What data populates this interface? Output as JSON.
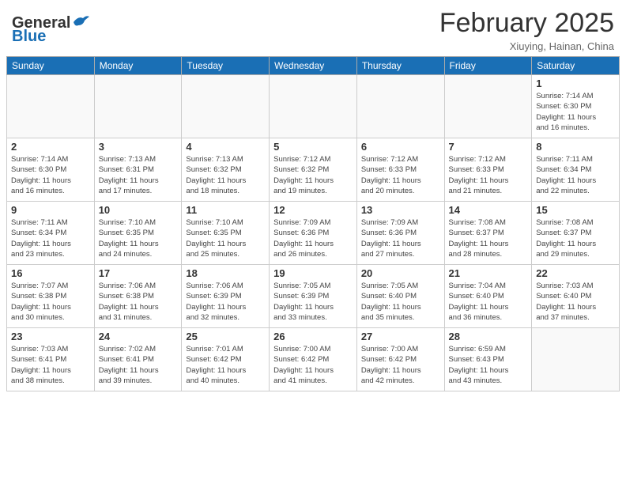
{
  "header": {
    "logo_general": "General",
    "logo_blue": "Blue",
    "month_year": "February 2025",
    "location": "Xiuying, Hainan, China"
  },
  "weekdays": [
    "Sunday",
    "Monday",
    "Tuesday",
    "Wednesday",
    "Thursday",
    "Friday",
    "Saturday"
  ],
  "weeks": [
    [
      {
        "day": "",
        "info": ""
      },
      {
        "day": "",
        "info": ""
      },
      {
        "day": "",
        "info": ""
      },
      {
        "day": "",
        "info": ""
      },
      {
        "day": "",
        "info": ""
      },
      {
        "day": "",
        "info": ""
      },
      {
        "day": "1",
        "info": "Sunrise: 7:14 AM\nSunset: 6:30 PM\nDaylight: 11 hours\nand 16 minutes."
      }
    ],
    [
      {
        "day": "2",
        "info": "Sunrise: 7:14 AM\nSunset: 6:30 PM\nDaylight: 11 hours\nand 16 minutes."
      },
      {
        "day": "3",
        "info": "Sunrise: 7:13 AM\nSunset: 6:31 PM\nDaylight: 11 hours\nand 17 minutes."
      },
      {
        "day": "4",
        "info": "Sunrise: 7:13 AM\nSunset: 6:32 PM\nDaylight: 11 hours\nand 18 minutes."
      },
      {
        "day": "5",
        "info": "Sunrise: 7:12 AM\nSunset: 6:32 PM\nDaylight: 11 hours\nand 19 minutes."
      },
      {
        "day": "6",
        "info": "Sunrise: 7:12 AM\nSunset: 6:33 PM\nDaylight: 11 hours\nand 20 minutes."
      },
      {
        "day": "7",
        "info": "Sunrise: 7:12 AM\nSunset: 6:33 PM\nDaylight: 11 hours\nand 21 minutes."
      },
      {
        "day": "8",
        "info": "Sunrise: 7:11 AM\nSunset: 6:34 PM\nDaylight: 11 hours\nand 22 minutes."
      }
    ],
    [
      {
        "day": "9",
        "info": "Sunrise: 7:11 AM\nSunset: 6:34 PM\nDaylight: 11 hours\nand 23 minutes."
      },
      {
        "day": "10",
        "info": "Sunrise: 7:10 AM\nSunset: 6:35 PM\nDaylight: 11 hours\nand 24 minutes."
      },
      {
        "day": "11",
        "info": "Sunrise: 7:10 AM\nSunset: 6:35 PM\nDaylight: 11 hours\nand 25 minutes."
      },
      {
        "day": "12",
        "info": "Sunrise: 7:09 AM\nSunset: 6:36 PM\nDaylight: 11 hours\nand 26 minutes."
      },
      {
        "day": "13",
        "info": "Sunrise: 7:09 AM\nSunset: 6:36 PM\nDaylight: 11 hours\nand 27 minutes."
      },
      {
        "day": "14",
        "info": "Sunrise: 7:08 AM\nSunset: 6:37 PM\nDaylight: 11 hours\nand 28 minutes."
      },
      {
        "day": "15",
        "info": "Sunrise: 7:08 AM\nSunset: 6:37 PM\nDaylight: 11 hours\nand 29 minutes."
      }
    ],
    [
      {
        "day": "16",
        "info": "Sunrise: 7:07 AM\nSunset: 6:38 PM\nDaylight: 11 hours\nand 30 minutes."
      },
      {
        "day": "17",
        "info": "Sunrise: 7:06 AM\nSunset: 6:38 PM\nDaylight: 11 hours\nand 31 minutes."
      },
      {
        "day": "18",
        "info": "Sunrise: 7:06 AM\nSunset: 6:39 PM\nDaylight: 11 hours\nand 32 minutes."
      },
      {
        "day": "19",
        "info": "Sunrise: 7:05 AM\nSunset: 6:39 PM\nDaylight: 11 hours\nand 33 minutes."
      },
      {
        "day": "20",
        "info": "Sunrise: 7:05 AM\nSunset: 6:40 PM\nDaylight: 11 hours\nand 35 minutes."
      },
      {
        "day": "21",
        "info": "Sunrise: 7:04 AM\nSunset: 6:40 PM\nDaylight: 11 hours\nand 36 minutes."
      },
      {
        "day": "22",
        "info": "Sunrise: 7:03 AM\nSunset: 6:40 PM\nDaylight: 11 hours\nand 37 minutes."
      }
    ],
    [
      {
        "day": "23",
        "info": "Sunrise: 7:03 AM\nSunset: 6:41 PM\nDaylight: 11 hours\nand 38 minutes."
      },
      {
        "day": "24",
        "info": "Sunrise: 7:02 AM\nSunset: 6:41 PM\nDaylight: 11 hours\nand 39 minutes."
      },
      {
        "day": "25",
        "info": "Sunrise: 7:01 AM\nSunset: 6:42 PM\nDaylight: 11 hours\nand 40 minutes."
      },
      {
        "day": "26",
        "info": "Sunrise: 7:00 AM\nSunset: 6:42 PM\nDaylight: 11 hours\nand 41 minutes."
      },
      {
        "day": "27",
        "info": "Sunrise: 7:00 AM\nSunset: 6:42 PM\nDaylight: 11 hours\nand 42 minutes."
      },
      {
        "day": "28",
        "info": "Sunrise: 6:59 AM\nSunset: 6:43 PM\nDaylight: 11 hours\nand 43 minutes."
      },
      {
        "day": "",
        "info": ""
      }
    ]
  ]
}
